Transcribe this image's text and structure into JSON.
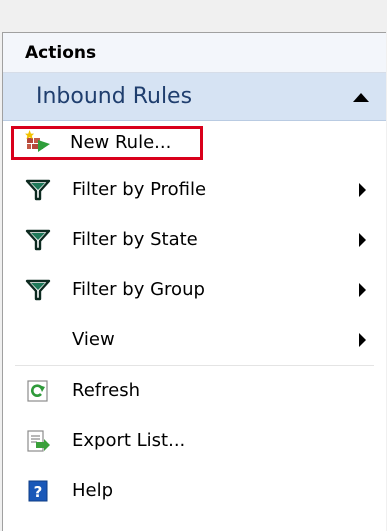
{
  "actions": {
    "header": "Actions",
    "section": {
      "title": "Inbound Rules",
      "items": [
        {
          "label": "New Rule...",
          "icon": "new-rule-icon",
          "has_submenu": false,
          "highlighted": true
        },
        {
          "label": "Filter by Profile",
          "icon": "filter-icon",
          "has_submenu": true
        },
        {
          "label": "Filter by State",
          "icon": "filter-icon",
          "has_submenu": true
        },
        {
          "label": "Filter by Group",
          "icon": "filter-icon",
          "has_submenu": true
        },
        {
          "label": "View",
          "icon": "",
          "has_submenu": true
        },
        {
          "label": "Refresh",
          "icon": "refresh-icon",
          "has_submenu": false
        },
        {
          "label": "Export List...",
          "icon": "export-list-icon",
          "has_submenu": false
        },
        {
          "label": "Help",
          "icon": "help-icon",
          "has_submenu": false
        }
      ]
    }
  },
  "colors": {
    "section_header_bg": "#d6e3f3",
    "highlight_border": "#d9001b"
  }
}
